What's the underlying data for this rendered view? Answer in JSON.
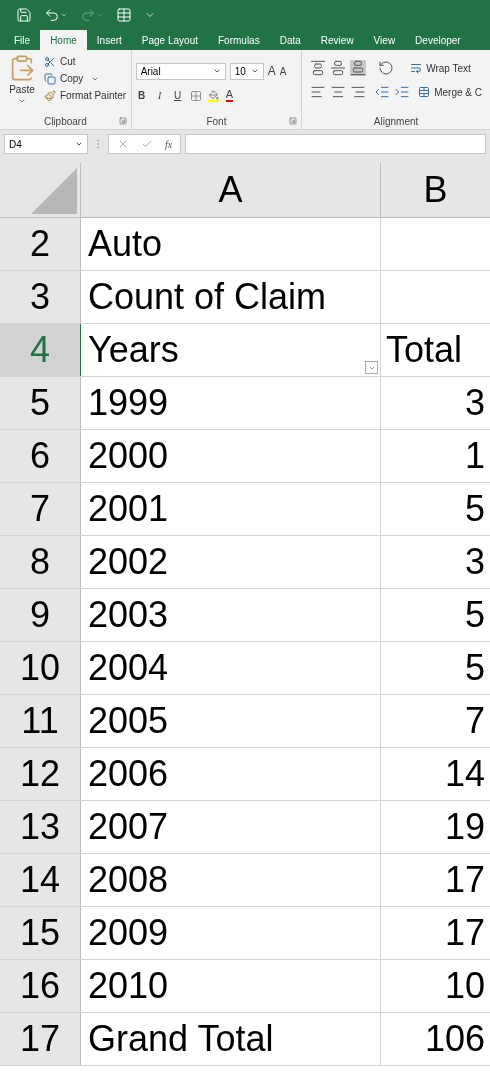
{
  "tabs": [
    {
      "label": "File",
      "selected": false
    },
    {
      "label": "Home",
      "selected": true
    },
    {
      "label": "Insert",
      "selected": false
    },
    {
      "label": "Page Layout",
      "selected": false
    },
    {
      "label": "Formulas",
      "selected": false
    },
    {
      "label": "Data",
      "selected": false
    },
    {
      "label": "Review",
      "selected": false
    },
    {
      "label": "View",
      "selected": false
    },
    {
      "label": "Developer",
      "selected": false
    }
  ],
  "clipboard": {
    "paste": "Paste",
    "cut": "Cut",
    "copy": "Copy",
    "format_painter": "Format Painter",
    "label": "Clipboard"
  },
  "font": {
    "name": "Arial",
    "size": "10",
    "grow": "A",
    "shrink": "A",
    "style_buttons": [
      "B",
      "I",
      "U"
    ],
    "color_button": "A",
    "label": "Font"
  },
  "alignment": {
    "wrap_text": "Wrap Text",
    "merge": "Merge & C",
    "label": "Alignment"
  },
  "name_box": "D4",
  "formula_fx": "fx",
  "columns": [
    "A",
    "B"
  ],
  "rows": [
    {
      "header": "2",
      "a": "Auto",
      "selected": false,
      "filter": false
    },
    {
      "header": "3",
      "a": "Count of Claim",
      "selected": false,
      "filter": false
    },
    {
      "header": "4",
      "a": "Years",
      "b": "Total",
      "selected": true,
      "filter": true
    },
    {
      "header": "5",
      "a": "1999",
      "b": "3",
      "selected": false,
      "filter": false
    },
    {
      "header": "6",
      "a": "2000",
      "b": "1",
      "selected": false,
      "filter": false
    },
    {
      "header": "7",
      "a": "2001",
      "b": "5",
      "selected": false,
      "filter": false
    },
    {
      "header": "8",
      "a": "2002",
      "b": "3",
      "selected": false,
      "filter": false
    },
    {
      "header": "9",
      "a": "2003",
      "b": "5",
      "selected": false,
      "filter": false
    },
    {
      "header": "10",
      "a": "2004",
      "b": "5",
      "selected": false,
      "filter": false
    },
    {
      "header": "11",
      "a": "2005",
      "b": "7",
      "selected": false,
      "filter": false
    },
    {
      "header": "12",
      "a": "2006",
      "b": "14",
      "selected": false,
      "filter": false
    },
    {
      "header": "13",
      "a": "2007",
      "b": "19",
      "selected": false,
      "filter": false
    },
    {
      "header": "14",
      "a": "2008",
      "b": "17",
      "selected": false,
      "filter": false
    },
    {
      "header": "15",
      "a": "2009",
      "b": "17",
      "selected": false,
      "filter": false
    },
    {
      "header": "16",
      "a": "2010",
      "b": "10",
      "selected": false,
      "filter": false
    },
    {
      "header": "17",
      "a": "Grand Total",
      "b": "106",
      "selected": false,
      "filter": false
    }
  ]
}
